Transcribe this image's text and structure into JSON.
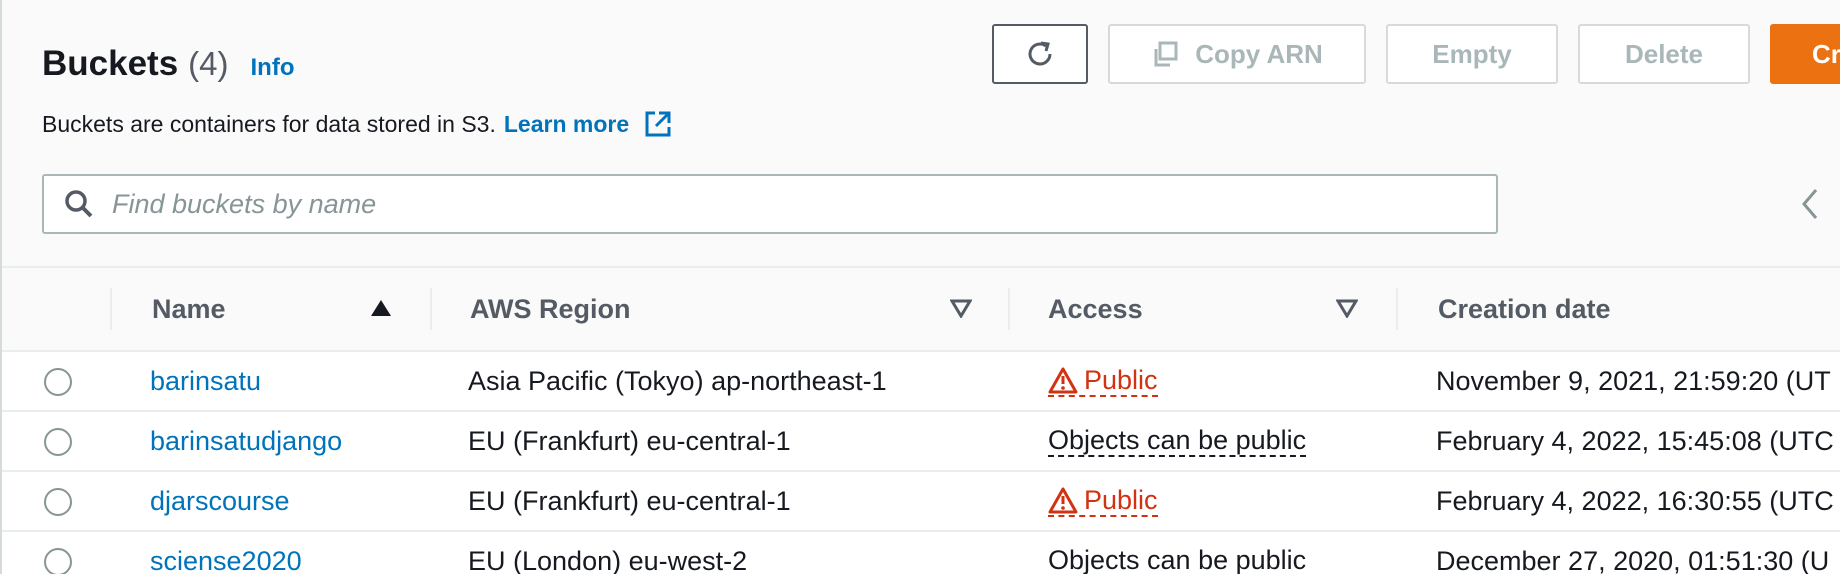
{
  "header": {
    "title": "Buckets",
    "count": "(4)",
    "info_label": "Info",
    "description": "Buckets are containers for data stored in S3.",
    "learn_more_label": "Learn more"
  },
  "toolbar": {
    "refresh_icon": "refresh-icon",
    "copy_arn_label": "Copy ARN",
    "empty_label": "Empty",
    "delete_label": "Delete",
    "create_label": "Cr"
  },
  "search": {
    "placeholder": "Find buckets by name",
    "value": ""
  },
  "table": {
    "columns": {
      "name": "Name",
      "region": "AWS Region",
      "access": "Access",
      "created": "Creation date"
    },
    "rows": [
      {
        "name": "barinsatu",
        "region": "Asia Pacific (Tokyo) ap-northeast-1",
        "access": "Public",
        "created": "November 9, 2021, 21:59:20 (UT"
      },
      {
        "name": "barinsatudjango",
        "region": "EU (Frankfurt) eu-central-1",
        "access": "Objects can be public",
        "created": "February 4, 2022, 15:45:08 (UTC"
      },
      {
        "name": "djarscourse",
        "region": "EU (Frankfurt) eu-central-1",
        "access": "Public",
        "created": "February 4, 2022, 16:30:55 (UTC"
      },
      {
        "name": "sciense2020",
        "region": "EU (London) eu-west-2",
        "access": "Objects can be public",
        "created": "December 27, 2020, 01:51:30 (U"
      }
    ]
  },
  "colors": {
    "link": "#0073bb",
    "primary": "#ec7211",
    "danger": "#d13212"
  }
}
